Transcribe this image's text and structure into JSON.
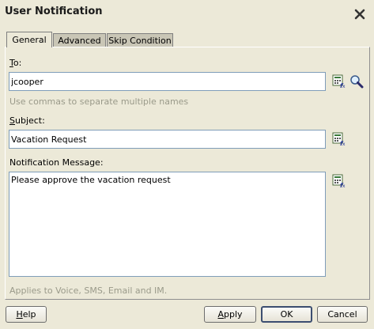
{
  "window": {
    "title": "User Notification"
  },
  "tabs": [
    {
      "label": "General"
    },
    {
      "label": "Advanced"
    },
    {
      "label": "Skip Condition"
    }
  ],
  "to": {
    "label": "To:",
    "value": "jcooper",
    "hint": "Use commas to separate multiple names"
  },
  "subject": {
    "label": "Subject:",
    "value": "Vacation Request"
  },
  "message": {
    "label": "Notification Message:",
    "value": "Please approve the vacation request",
    "hint": "Applies to Voice, SMS, Email and IM."
  },
  "buttons": {
    "help": "Help",
    "apply": "Apply",
    "ok": "OK",
    "cancel": "Cancel"
  },
  "icons": {
    "close": "close-x-icon",
    "expression_builder": "expression-builder-icon",
    "search": "magnifier-search-icon"
  }
}
